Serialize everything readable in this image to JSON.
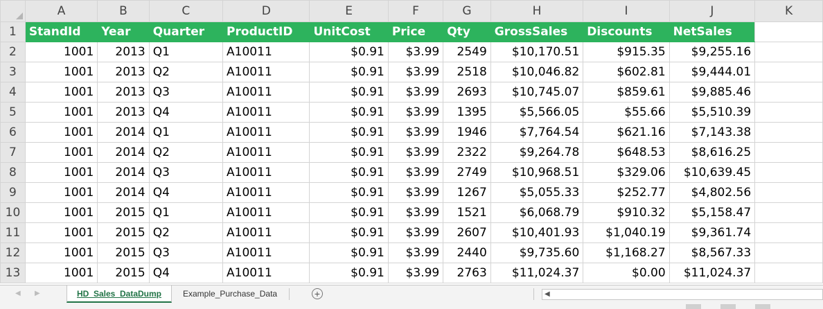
{
  "columns": [
    "A",
    "B",
    "C",
    "D",
    "E",
    "F",
    "G",
    "H",
    "I",
    "J",
    "K"
  ],
  "rows": [
    {
      "n": "1",
      "cells": [
        "StandId",
        "Year",
        "Quarter",
        "ProductID",
        "UnitCost",
        "Price",
        "Qty",
        "GrossSales",
        "Discounts",
        "NetSales",
        ""
      ]
    },
    {
      "n": "2",
      "cells": [
        "1001",
        "2013",
        "Q1",
        "A10011",
        "$0.91",
        "$3.99",
        "2549",
        "$10,170.51",
        "$915.35",
        "$9,255.16",
        ""
      ]
    },
    {
      "n": "3",
      "cells": [
        "1001",
        "2013",
        "Q2",
        "A10011",
        "$0.91",
        "$3.99",
        "2518",
        "$10,046.82",
        "$602.81",
        "$9,444.01",
        ""
      ]
    },
    {
      "n": "4",
      "cells": [
        "1001",
        "2013",
        "Q3",
        "A10011",
        "$0.91",
        "$3.99",
        "2693",
        "$10,745.07",
        "$859.61",
        "$9,885.46",
        ""
      ]
    },
    {
      "n": "5",
      "cells": [
        "1001",
        "2013",
        "Q4",
        "A10011",
        "$0.91",
        "$3.99",
        "1395",
        "$5,566.05",
        "$55.66",
        "$5,510.39",
        ""
      ]
    },
    {
      "n": "6",
      "cells": [
        "1001",
        "2014",
        "Q1",
        "A10011",
        "$0.91",
        "$3.99",
        "1946",
        "$7,764.54",
        "$621.16",
        "$7,143.38",
        ""
      ]
    },
    {
      "n": "7",
      "cells": [
        "1001",
        "2014",
        "Q2",
        "A10011",
        "$0.91",
        "$3.99",
        "2322",
        "$9,264.78",
        "$648.53",
        "$8,616.25",
        ""
      ]
    },
    {
      "n": "8",
      "cells": [
        "1001",
        "2014",
        "Q3",
        "A10011",
        "$0.91",
        "$3.99",
        "2749",
        "$10,968.51",
        "$329.06",
        "$10,639.45",
        ""
      ]
    },
    {
      "n": "9",
      "cells": [
        "1001",
        "2014",
        "Q4",
        "A10011",
        "$0.91",
        "$3.99",
        "1267",
        "$5,055.33",
        "$252.77",
        "$4,802.56",
        ""
      ]
    },
    {
      "n": "10",
      "cells": [
        "1001",
        "2015",
        "Q1",
        "A10011",
        "$0.91",
        "$3.99",
        "1521",
        "$6,068.79",
        "$910.32",
        "$5,158.47",
        ""
      ]
    },
    {
      "n": "11",
      "cells": [
        "1001",
        "2015",
        "Q2",
        "A10011",
        "$0.91",
        "$3.99",
        "2607",
        "$10,401.93",
        "$1,040.19",
        "$9,361.74",
        ""
      ]
    },
    {
      "n": "12",
      "cells": [
        "1001",
        "2015",
        "Q3",
        "A10011",
        "$0.91",
        "$3.99",
        "2440",
        "$9,735.60",
        "$1,168.27",
        "$8,567.33",
        ""
      ]
    },
    {
      "n": "13",
      "cells": [
        "1001",
        "2015",
        "Q4",
        "A10011",
        "$0.91",
        "$3.99",
        "2763",
        "$11,024.37",
        "$0.00",
        "$11,024.37",
        ""
      ]
    }
  ],
  "sheet_tabs": [
    "HD_Sales_DataDump",
    "Example_Purchase_Data"
  ],
  "active_tab": "HD_Sales_DataDump",
  "icons": {
    "add_sheet": "plus-circle-icon",
    "scroll_left": "arrow-left-icon",
    "tab_prev": "triangle-left-icon",
    "tab_next": "triangle-right-icon"
  },
  "colors": {
    "header_fill": "#2db35d",
    "header_text": "#ffffff",
    "active_tab_text": "#217346"
  }
}
